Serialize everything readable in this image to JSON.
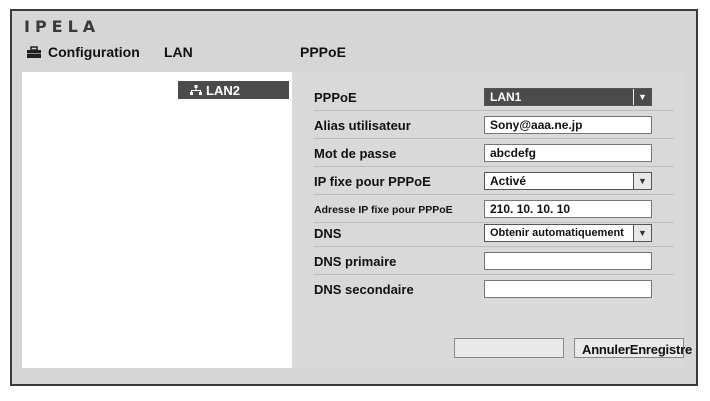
{
  "brand": {
    "logo": "IPELA"
  },
  "header": {
    "configuration": "Configuration",
    "section": "LAN",
    "subsection": "PPPoE"
  },
  "sidebar": {
    "items": [
      {
        "label": "LAN2"
      }
    ]
  },
  "form": {
    "rows": [
      {
        "label": "PPPoE",
        "type": "select",
        "value": "LAN1"
      },
      {
        "label": "Alias utilisateur",
        "type": "input",
        "value": "Sony@aaa.ne.jp"
      },
      {
        "label": "Mot de passe",
        "type": "input",
        "value": "abcdefg"
      },
      {
        "label": "IP fixe pour PPPoE",
        "type": "select",
        "value": "Activé"
      },
      {
        "label": "Adresse IP fixe pour PPPoE",
        "type": "input",
        "value": "210. 10. 10. 10"
      },
      {
        "label": "DNS",
        "type": "select",
        "value": "Obtenir automatiquement"
      },
      {
        "label": "DNS primaire",
        "type": "input",
        "value": ""
      },
      {
        "label": "DNS secondaire",
        "type": "input",
        "value": ""
      }
    ]
  },
  "buttons": {
    "cancel": "Annuler",
    "save": "Enregistre"
  }
}
